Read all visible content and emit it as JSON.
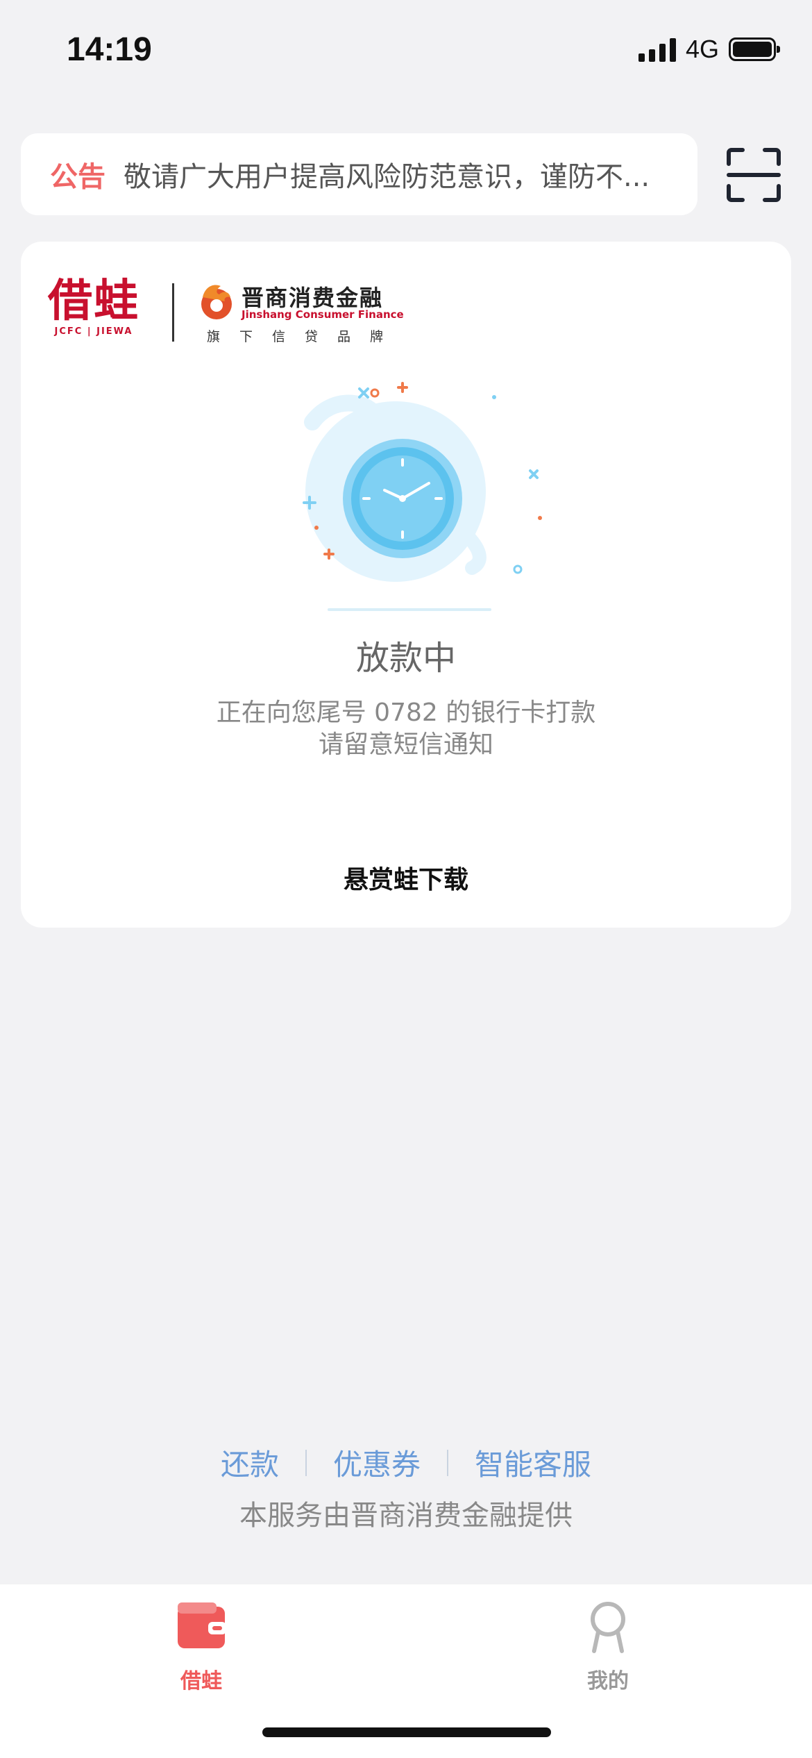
{
  "status_bar": {
    "time": "14:19",
    "network": "4G",
    "icons": [
      "signal-icon",
      "battery-icon"
    ]
  },
  "notice": {
    "tag": "公告",
    "text": "敬请广大用户提高风险防范意识，谨防不...",
    "scan_icon": "scan-icon"
  },
  "brand": {
    "name": "借蛙",
    "sub": "JCFC | JIEWA",
    "partner_cn": "晋商消费金融",
    "partner_en": "Jinshang Consumer Finance",
    "partner_tag": "旗下信贷品牌"
  },
  "loan_status": {
    "illustration": "clock-icon",
    "title": "放款中",
    "desc_line1": "正在向您尾号 0782 的银行卡打款",
    "desc_line2": "请留意短信通知",
    "reward_link": "悬赏蛙下载"
  },
  "footer": {
    "links": [
      "还款",
      "优惠券",
      "智能客服"
    ],
    "note": "本服务由晋商消费金融提供"
  },
  "tab_bar": {
    "items": [
      {
        "label": "借蛙",
        "icon": "wallet-icon",
        "active": true
      },
      {
        "label": "我的",
        "icon": "profile-icon",
        "active": false
      }
    ]
  },
  "colors": {
    "accent": "#ef5a5a",
    "link": "#6a9bd8",
    "brand_red": "#c8102e"
  }
}
